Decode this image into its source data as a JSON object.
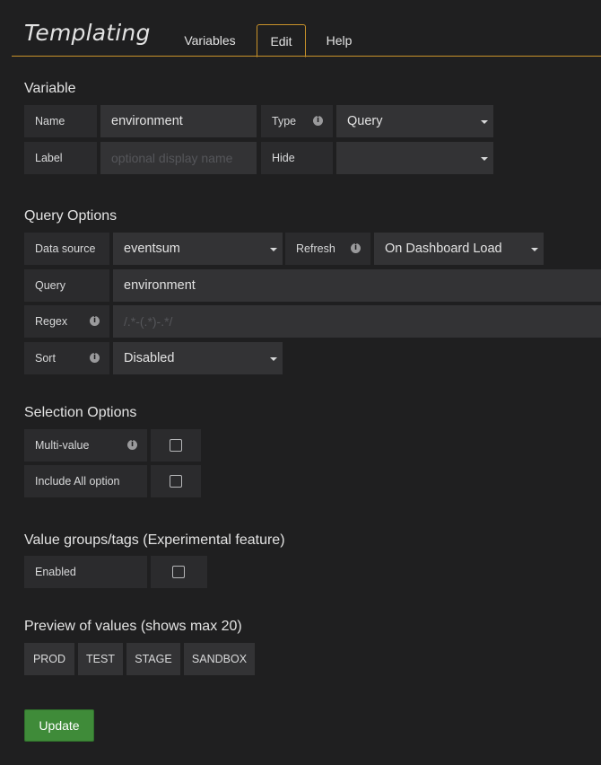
{
  "header": {
    "title": "Templating",
    "tabs": [
      {
        "label": "Variables"
      },
      {
        "label": "Edit"
      },
      {
        "label": "Help"
      }
    ]
  },
  "variable": {
    "title": "Variable",
    "name_label": "Name",
    "name_value": "environment",
    "type_label": "Type",
    "type_value": "Query",
    "label_label": "Label",
    "label_placeholder": "optional display name",
    "hide_label": "Hide",
    "hide_value": ""
  },
  "query_options": {
    "title": "Query Options",
    "datasource_label": "Data source",
    "datasource_value": "eventsum",
    "refresh_label": "Refresh",
    "refresh_value": "On Dashboard Load",
    "query_label": "Query",
    "query_value": "environment",
    "regex_label": "Regex",
    "regex_placeholder": "/.*-(.*)-.*/",
    "sort_label": "Sort",
    "sort_value": "Disabled"
  },
  "selection_options": {
    "title": "Selection Options",
    "multi_label": "Multi-value",
    "multi_checked": false,
    "include_all_label": "Include All option",
    "include_all_checked": false
  },
  "value_groups": {
    "title": "Value groups/tags (Experimental feature)",
    "enabled_label": "Enabled",
    "enabled_checked": false
  },
  "preview": {
    "title": "Preview of values (shows max 20)",
    "values": [
      "PROD",
      "TEST",
      "STAGE",
      "SANDBOX"
    ]
  },
  "update_label": "Update",
  "colors": {
    "background": "#1f1f20",
    "label_bg": "#2b2b2d",
    "input_bg": "#333335",
    "accent": "#c8922a",
    "update_button": "#3f8b39"
  }
}
